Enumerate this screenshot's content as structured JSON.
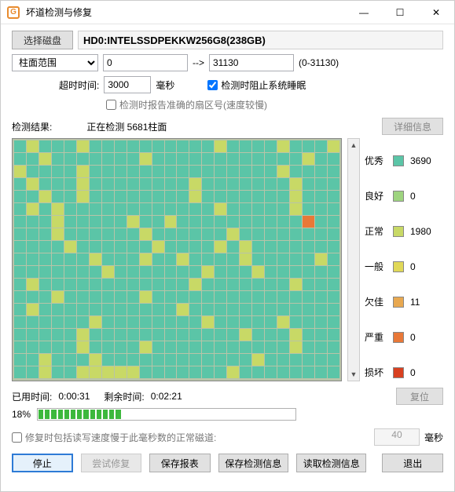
{
  "title": "坏道检测与修复",
  "titlebar": {
    "min": "—",
    "max": "☐",
    "close": "✕"
  },
  "disk": {
    "select_btn": "选择磁盘",
    "path": "HD0:INTELSSDPEKKW256G8(238GB)"
  },
  "range": {
    "mode": "柱面范围",
    "from": "0",
    "arrow": "-->",
    "to": "31130",
    "hint": "(0-31130)"
  },
  "timeout": {
    "label": "超时时间:",
    "value": "3000",
    "unit": "毫秒"
  },
  "opts": {
    "sleep": "检测时阻止系统睡眠",
    "sleep_checked": true,
    "accurate": "检测时报告准确的扇区号(速度较慢)",
    "accurate_checked": false
  },
  "result": {
    "label": "检测结果:",
    "status": "正在检测 5681柱面",
    "detail_btn": "详细信息"
  },
  "legend": [
    {
      "label": "优秀",
      "count": "3690",
      "color": "#5bc5a7"
    },
    {
      "label": "良好",
      "count": "0",
      "color": "#9ed47f"
    },
    {
      "label": "正常",
      "count": "1980",
      "color": "#c8d966"
    },
    {
      "label": "一般",
      "count": "0",
      "color": "#e0d858"
    },
    {
      "label": "欠佳",
      "count": "11",
      "color": "#e8a850"
    },
    {
      "label": "严重",
      "count": "0",
      "color": "#e87838"
    },
    {
      "label": "损坏",
      "count": "0",
      "color": "#d84020"
    }
  ],
  "time": {
    "elapsed_lbl": "已用时间:",
    "elapsed": "0:00:31",
    "remain_lbl": "剩余时间:",
    "remain": "0:02:21",
    "reset_btn": "复位"
  },
  "progress": {
    "percent": "18%",
    "filled": 13,
    "total": 40
  },
  "repair": {
    "checkbox": "修复时包括读写速度慢于此毫秒数的正常磁道:",
    "checked": false,
    "ms": "40",
    "unit": "毫秒"
  },
  "buttons": {
    "stop": "停止",
    "try_repair": "尝试修复",
    "save_report": "保存报表",
    "save_info": "保存检测信息",
    "load_info": "读取检测信息",
    "exit": "退出"
  },
  "grid": {
    "cols": 26,
    "rows": 19,
    "pattern": "eneeeneeeeeeeeeeneeeeneeeneeneeeeeeeneeeeeeeeeeeeneeneeeeneeeeeeeeeeeeeeeneeeeeneeeneeeeeeeeneeeeeeeneeeeeneeneeeeeeeeneeeeeeeneeeeneneeeeeeeeeeeeneeeeeneeeeeeneeeeeneeneeeeeeeeeeseeeeeneeeeeeneeeeeeneeeeeeeeeeeeneeeeeeneeeeneneeeeeeeeeeeeeneeeneeneeeeneeeeeneeeeeeeeneeeeeeeneeeneeeeeeeneeeeeeeeeeeeneeeeeeeneeeeeeneeeeeeneeeeeeeeeeeeeeeeneeeeeeeeeeeneeeeeeeeeeeeeeeeeeneeeeeeeeneeeeeneeeeeeeeeneeeeeeeeeeeeneeeneeeeeeeeneeeeneeeeeeeeeeeneeeeeneeeneeeeeeeeeeeeneeeeeeeeneennnnneeeeeeen"
  }
}
